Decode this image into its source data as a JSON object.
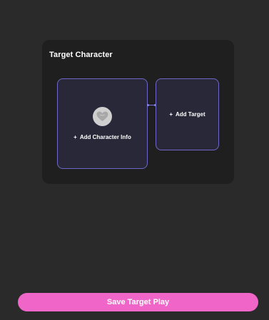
{
  "card": {
    "title": "Target Character"
  },
  "main_slot": {
    "plus": "+",
    "label": "Add Character Info",
    "avatar_icon": "heart-avatar-icon"
  },
  "target_slot": {
    "plus": "+",
    "label": "Add Target"
  },
  "footer": {
    "save_label": "Save Target Play"
  },
  "colors": {
    "background": "#2a2a2a",
    "card": "#1f1f1f",
    "slot_border": "#6e68c8",
    "accent": "#f066c8"
  }
}
